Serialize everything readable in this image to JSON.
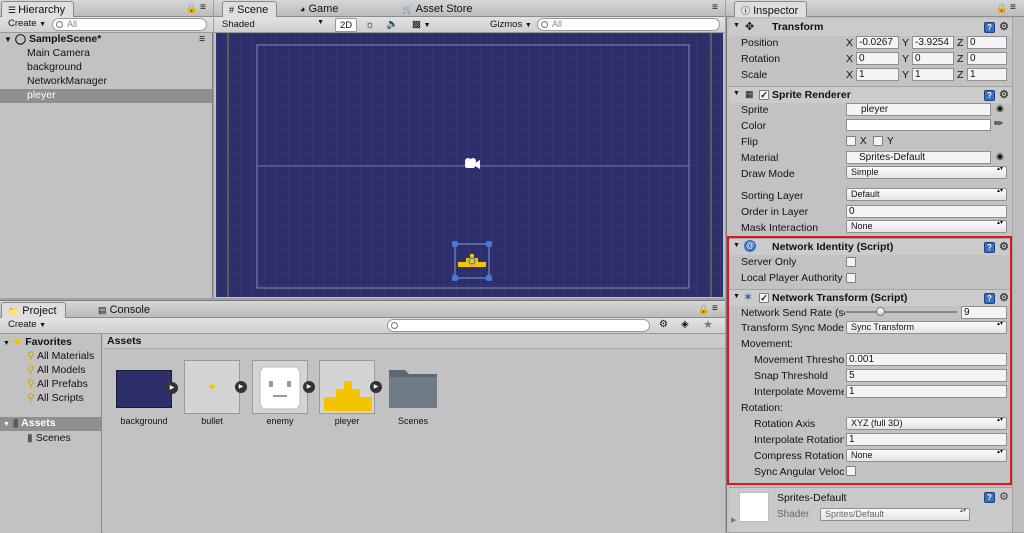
{
  "hierarchy": {
    "tab": "Hierarchy",
    "create": "Create",
    "search_placeholder": "All",
    "scene": "SampleScene*",
    "items": [
      "Main Camera",
      "background",
      "NetworkManager",
      "pleyer"
    ]
  },
  "scene": {
    "tabs": [
      "Scene",
      "Game",
      "Asset Store"
    ],
    "shading": "Shaded",
    "mode2d": "2D",
    "gizmos": "Gizmos",
    "search_placeholder": "All"
  },
  "project": {
    "tabs": [
      "Project",
      "Console"
    ],
    "create": "Create",
    "favorites_title": "Favorites",
    "favorites": [
      "All Materials",
      "All Models",
      "All Prefabs",
      "All Scripts"
    ],
    "assets_folder": "Assets",
    "subfolders": [
      "Scenes"
    ],
    "assets_header": "Assets",
    "assets": [
      "background",
      "bullet",
      "enemy",
      "pleyer",
      "Scenes"
    ]
  },
  "inspector": {
    "tab": "Inspector",
    "transform": {
      "title": "Transform",
      "position_label": "Position",
      "rotation_label": "Rotation",
      "scale_label": "Scale",
      "axes": [
        "X",
        "Y",
        "Z"
      ],
      "position": [
        "-0.0267",
        "-3.9254",
        "0"
      ],
      "rotation": [
        "0",
        "0",
        "0"
      ],
      "scale": [
        "1",
        "1",
        "1"
      ]
    },
    "sprite_renderer": {
      "title": "Sprite Renderer",
      "sprite_label": "Sprite",
      "sprite": "pleyer",
      "color_label": "Color",
      "flip_label": "Flip",
      "flip_x": "X",
      "flip_y": "Y",
      "material_label": "Material",
      "material": "Sprites-Default",
      "draw_mode_label": "Draw Mode",
      "draw_mode": "Simple",
      "sorting_layer_label": "Sorting Layer",
      "sorting_layer": "Default",
      "order_label": "Order in Layer",
      "order": "0",
      "mask_label": "Mask Interaction",
      "mask": "None"
    },
    "network_identity": {
      "title": "Network Identity (Script)",
      "server_only": "Server Only",
      "local_player": "Local Player Authority"
    },
    "network_transform": {
      "title": "Network Transform (Script)",
      "send_rate_label": "Network Send Rate (se",
      "send_rate": "9",
      "send_rate_fraction": 0.3,
      "sync_mode_label": "Transform Sync Mode",
      "sync_mode": "Sync Transform",
      "movement_label": "Movement:",
      "move_threshold_label": "Movement Thresho",
      "move_threshold": "0.001",
      "snap_label": "Snap Threshold",
      "snap": "5",
      "interp_move_label": "Interpolate Moveme",
      "interp_move": "1",
      "rotation_section_label": "Rotation:",
      "rot_axis_label": "Rotation Axis",
      "rot_axis": "XYZ (full 3D)",
      "interp_rot_label": "Interpolate Rotation",
      "interp_rot": "1",
      "compress_label": "Compress Rotation",
      "compress": "None",
      "sync_ang_label": "Sync Angular Veloc"
    },
    "material": {
      "name": "Sprites-Default",
      "shader_label": "Shader",
      "shader": "Sprites/Default"
    }
  },
  "colors": {
    "highlight": "#e0141e",
    "scene_bg": "#2d2f6a",
    "selection": "#8f8f8f",
    "help_icon": "#3a6fbf",
    "sprite_yellow": "#f4c400"
  }
}
